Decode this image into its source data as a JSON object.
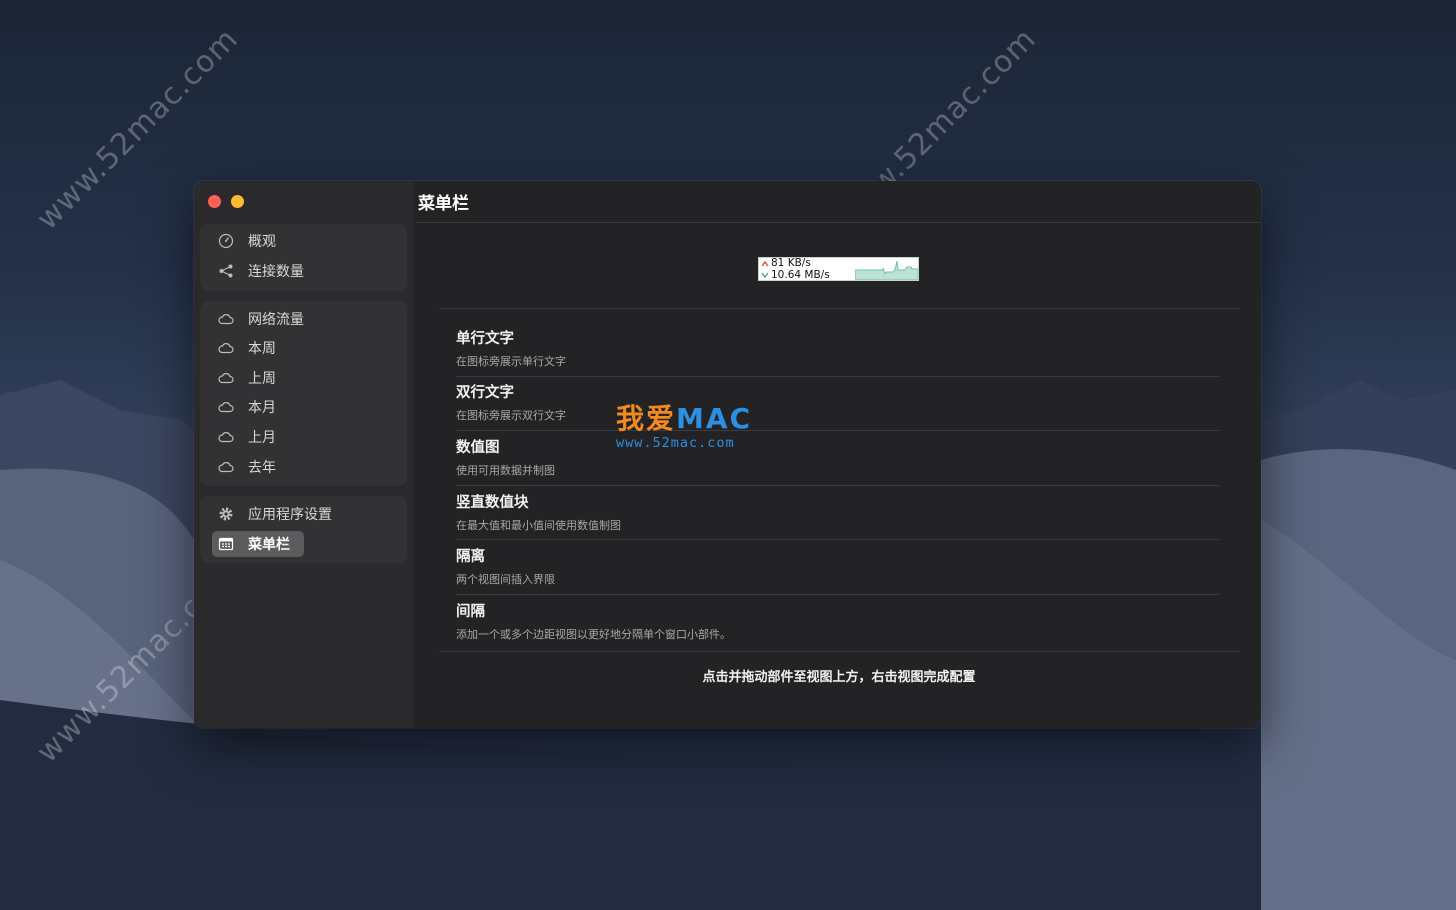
{
  "window": {
    "title": "菜单栏"
  },
  "sidebar": {
    "group1": [
      {
        "label": "概观",
        "icon": "gauge-icon"
      },
      {
        "label": "连接数量",
        "icon": "share-icon"
      }
    ],
    "group2": [
      {
        "label": "网络流量",
        "icon": "cloud-icon"
      },
      {
        "label": "本周",
        "icon": "cloud-icon"
      },
      {
        "label": "上周",
        "icon": "cloud-icon"
      },
      {
        "label": "本月",
        "icon": "cloud-icon"
      },
      {
        "label": "上月",
        "icon": "cloud-icon"
      },
      {
        "label": "去年",
        "icon": "cloud-icon"
      }
    ],
    "group3": [
      {
        "label": "应用程序设置",
        "icon": "gear-icon"
      },
      {
        "label": "菜单栏",
        "icon": "menubar-icon",
        "selected": true
      }
    ]
  },
  "preview": {
    "upload": "81 KB/s",
    "download": "10.64 MB/s"
  },
  "widgets": [
    {
      "title": "单行文字",
      "subtitle": "在图标旁展示单行文字"
    },
    {
      "title": "双行文字",
      "subtitle": "在图标旁展示双行文字"
    },
    {
      "title": "数值图",
      "subtitle": "使用可用数据并制图"
    },
    {
      "title": "竖直数值块",
      "subtitle": "在最大值和最小值间使用数值制图"
    },
    {
      "title": "隔离",
      "subtitle": "两个视图间插入界限"
    },
    {
      "title": "间隔",
      "subtitle": "添加一个或多个边距视图以更好地分隔单个窗口小部件。"
    }
  ],
  "footer": "点击并拖动部件至视图上方，右击视图完成配置",
  "watermark": {
    "text": "www.52mac.com",
    "logo_cn": "我爱",
    "logo_en": "MAC",
    "logo_url": "www.52mac.com"
  },
  "colors": {
    "close": "#fe5f57",
    "minimize": "#febb2e",
    "logo_orange": "#f28a1d",
    "logo_blue": "#2c8fe0"
  }
}
